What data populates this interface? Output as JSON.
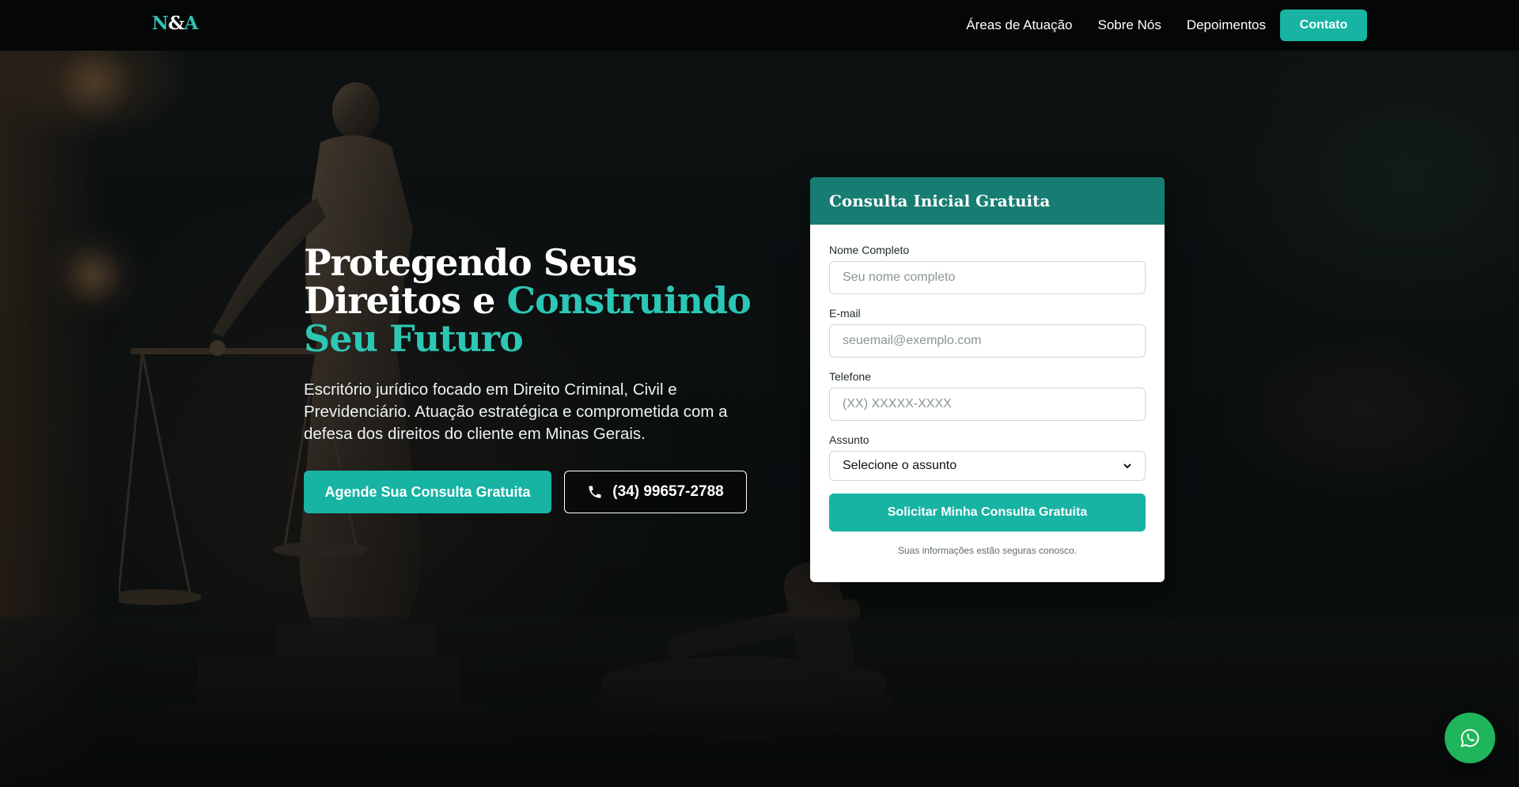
{
  "nav": {
    "logo_left": "N",
    "logo_amp": "&",
    "logo_right": "A",
    "links": [
      "Áreas de Atuação",
      "Sobre Nós",
      "Depoimentos"
    ],
    "cta": "Contato"
  },
  "hero": {
    "title_part1": "Protegendo Seus Direitos e ",
    "title_accent": "Construindo Seu Futuro",
    "subtitle": "Escritório jurídico focado em Direito Criminal, Civil e Previdenciário. Atuação estratégica e comprometida com a defesa dos direitos do cliente em Minas Gerais.",
    "primary_button": "Agende Sua Consulta Gratuita",
    "phone_button": "(34) 99657-2788",
    "phone_icon": "phone-icon"
  },
  "form": {
    "title": "Consulta Inicial Gratuita",
    "name_label": "Nome Completo",
    "name_placeholder": "Seu nome completo",
    "email_label": "E-mail",
    "email_placeholder": "seuemail@exemplo.com",
    "phone_label": "Telefone",
    "phone_placeholder": "(XX) XXXXX-XXXX",
    "subject_label": "Assunto",
    "subject_selected": "Selecione o assunto",
    "submit": "Solicitar Minha Consulta Gratuita",
    "note": "Suas informações estão seguras conosco."
  },
  "floating": {
    "whatsapp_icon": "whatsapp-icon"
  },
  "colors": {
    "accent": "#17b3a3",
    "accent_text": "#2cc7b4",
    "card_header": "#177c72",
    "nav_bg": "#050606",
    "whatsapp": "#1fb55a"
  }
}
